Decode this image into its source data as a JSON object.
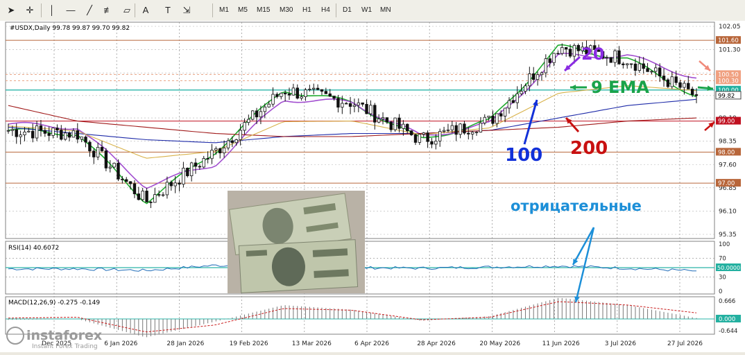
{
  "toolbar": {
    "tools": [
      {
        "icon": "cursor-icon",
        "glyph": "➤"
      },
      {
        "icon": "crosshair-icon",
        "glyph": "✛"
      },
      {
        "icon": "vertical-line-icon",
        "glyph": "│"
      },
      {
        "icon": "horizontal-line-icon",
        "glyph": "―"
      },
      {
        "icon": "trendline-icon",
        "glyph": "╱"
      },
      {
        "icon": "fibonacci-icon",
        "glyph": "≢"
      },
      {
        "icon": "channel-icon",
        "glyph": "▱"
      },
      {
        "icon": "text-icon",
        "glyph": "A"
      },
      {
        "icon": "text-label-icon",
        "glyph": "T"
      },
      {
        "icon": "arrows-icon",
        "glyph": "⇲"
      }
    ],
    "timeframes": [
      "M1",
      "M5",
      "M15",
      "M30",
      "H1",
      "H4",
      "D1",
      "W1",
      "MN"
    ]
  },
  "chart": {
    "symbol_info": "#USDX,Daily  99.78 99.87 99.70 99.82",
    "rsi_label": "RSI(14) 40.6072",
    "macd_label": "MACD(12,26,9) -0.275 -0.149",
    "watermark_brand": "instaforex",
    "watermark_tagline": "Instant Forex Trading",
    "price_labels": [
      "102.05",
      "101.30",
      "100.55",
      "99.82",
      "99.10",
      "98.35",
      "97.60",
      "96.85",
      "96.10",
      "95.35"
    ],
    "rsi_axis": [
      "100",
      "70",
      "50",
      "30",
      "0"
    ],
    "macd_axis": [
      "0.666",
      "-0.644"
    ],
    "date_labels": [
      "Dec 2025",
      "6 Jan 2026",
      "28 Jan 2026",
      "19 Feb 2026",
      "13 Mar 2026",
      "6 Apr 2026",
      "28 Apr 2026",
      "20 May 2026",
      "11 Jun 2026",
      "3 Jul 2026",
      "27 Jul 2026"
    ],
    "current_price_tag": "99.82",
    "annotations": {
      "ema9": "9 EMA",
      "ma20": "20",
      "ma100": "100",
      "ma200": "200",
      "negative": "отрицательные"
    },
    "colors": {
      "candles": "#111111",
      "ema9": "#1faa2e",
      "ma20": "#a24fd0",
      "ma50": "#d8b24a",
      "ma100": "#1d2aa8",
      "ma200": "#a01818",
      "rsi": "#1e6bb8",
      "macd_hist": "#777777",
      "macd_signal": "#c81818",
      "annotation_green": "#1aa34a",
      "annotation_purple": "#8a2be2",
      "annotation_blue": "#1230d8",
      "annotation_red": "#c81010",
      "annotation_cyan": "#1c8fd8"
    }
  },
  "chart_data": {
    "type": "line",
    "symbol": "#USDX",
    "timeframe": "Daily",
    "ohlc_last": {
      "open": 99.78,
      "high": 99.87,
      "low": 99.7,
      "close": 99.82
    },
    "x": [
      "Dec 2025",
      "6 Jan 2026",
      "28 Jan 2026",
      "19 Feb 2026",
      "13 Mar 2026",
      "6 Apr 2026",
      "28 Apr 2026",
      "20 May 2026",
      "11 Jun 2026",
      "3 Jul 2026",
      "27 Jul 2026"
    ],
    "series": [
      {
        "name": "9 EMA",
        "values": [
          98.7,
          98.6,
          96.4,
          98.0,
          100.0,
          99.6,
          98.4,
          99.0,
          101.4,
          101.0,
          99.8
        ]
      },
      {
        "name": "20",
        "values": [
          98.9,
          98.8,
          96.9,
          97.6,
          99.7,
          99.6,
          98.5,
          98.9,
          101.1,
          101.1,
          100.4
        ]
      },
      {
        "name": "100",
        "values": [
          98.8,
          98.6,
          98.4,
          98.3,
          98.5,
          98.6,
          98.6,
          98.7,
          99.1,
          99.5,
          99.7
        ]
      },
      {
        "name": "200",
        "values": [
          99.5,
          99.0,
          98.8,
          98.6,
          98.5,
          98.5,
          98.6,
          98.7,
          98.8,
          99.0,
          99.1
        ]
      }
    ],
    "horizontal_levels": [
      101.6,
      100.5,
      100.3,
      100.0,
      99.0,
      98.0,
      97.0
    ],
    "ylim": [
      95.35,
      102.05
    ],
    "rsi": {
      "period": 14,
      "value": 40.6072,
      "levels": [
        70,
        50,
        30
      ]
    },
    "macd": {
      "fast": 12,
      "slow": 26,
      "signal": 9,
      "main": -0.275,
      "signal_value": -0.149
    },
    "grid": true
  }
}
